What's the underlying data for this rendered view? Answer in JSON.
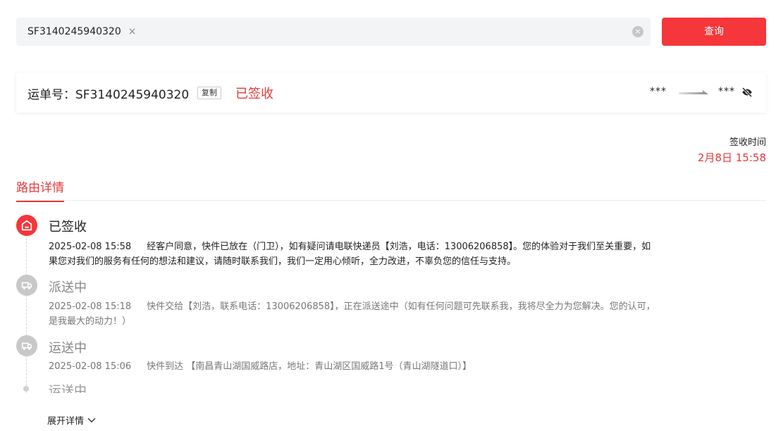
{
  "search": {
    "tag_value": "SF3140245940320",
    "tag_close": "×",
    "clear": "×",
    "button_label": "查询"
  },
  "waybill": {
    "label": "运单号：SF3140245940320",
    "copy_label": "复制",
    "status": "已签收",
    "from": "***",
    "to": "***"
  },
  "signed": {
    "label": "签收时间",
    "time": "2月8日 15:58"
  },
  "tab": {
    "label": "路由详情"
  },
  "timeline": [
    {
      "status": "已签收",
      "time": "2025-02-08 15:58",
      "text": "经客户同意，快件已放在（门卫），如有疑问请电联快递员【刘浩，电话：13006206858】。您的体验对于我们至关重要，如果您对我们的服务有任何的想法和建议，请随时联系我们，我们一定用心倾听，全力改进，不辜负您的信任与支持。"
    },
    {
      "status": "派送中",
      "time": "2025-02-08 15:18",
      "text": "快件交给【刘浩，联系电话：13006206858】，正在派送途中（如有任何问题可先联系我，我将尽全力为您解决。您的认可，是我最大的动力！）"
    },
    {
      "status": "运送中",
      "time": "2025-02-08 15:06",
      "text": "快件到达 【南昌青山湖国威路店，地址：青山湖区国威路1号（青山湖隧道口）】"
    },
    {
      "status": "运送中"
    }
  ],
  "expand": {
    "label": "展开详情"
  },
  "colors": {
    "accent": "#f5363a",
    "status_red": "#e63a3a",
    "inactive": "#c8c8c8"
  },
  "icons": [
    "close-icon",
    "clear-icon",
    "arrow-right-icon",
    "eye-off-icon",
    "home-signed-icon",
    "truck-icon",
    "chevron-down-icon"
  ]
}
